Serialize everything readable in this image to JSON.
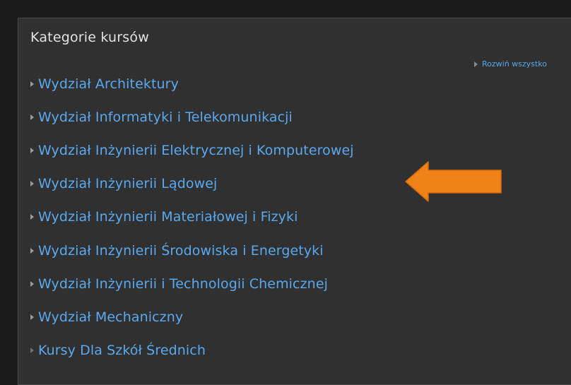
{
  "panel": {
    "title": "Kategorie kursów",
    "expand_all_label": "Rozwiń wszystko"
  },
  "categories": [
    {
      "label": "Wydział Architektury",
      "has_children": true
    },
    {
      "label": "Wydział Informatyki i Telekomunikacji",
      "has_children": true
    },
    {
      "label": "Wydział Inżynierii Elektrycznej i Komputerowej",
      "has_children": true
    },
    {
      "label": "Wydział Inżynierii Lądowej",
      "has_children": true
    },
    {
      "label": "Wydział Inżynierii Materiałowej i Fizyki",
      "has_children": true
    },
    {
      "label": "Wydział Inżynierii Środowiska i Energetyki",
      "has_children": true
    },
    {
      "label": "Wydział Inżynierii i Technologii Chemicznej",
      "has_children": true
    },
    {
      "label": "Wydział Mechaniczny",
      "has_children": true
    },
    {
      "label": "Kursy Dla Szkół Średnich",
      "has_children": false
    }
  ],
  "colors": {
    "page_background": "#1c1c1c",
    "panel_background": "#303030",
    "link": "#5aa9ee",
    "title_text": "#e2e2e2",
    "annotation_arrow": "#f0821a"
  },
  "annotation": {
    "icon": "left-arrow-icon",
    "points_to": "Wydział Inżynierii Lądowej"
  }
}
